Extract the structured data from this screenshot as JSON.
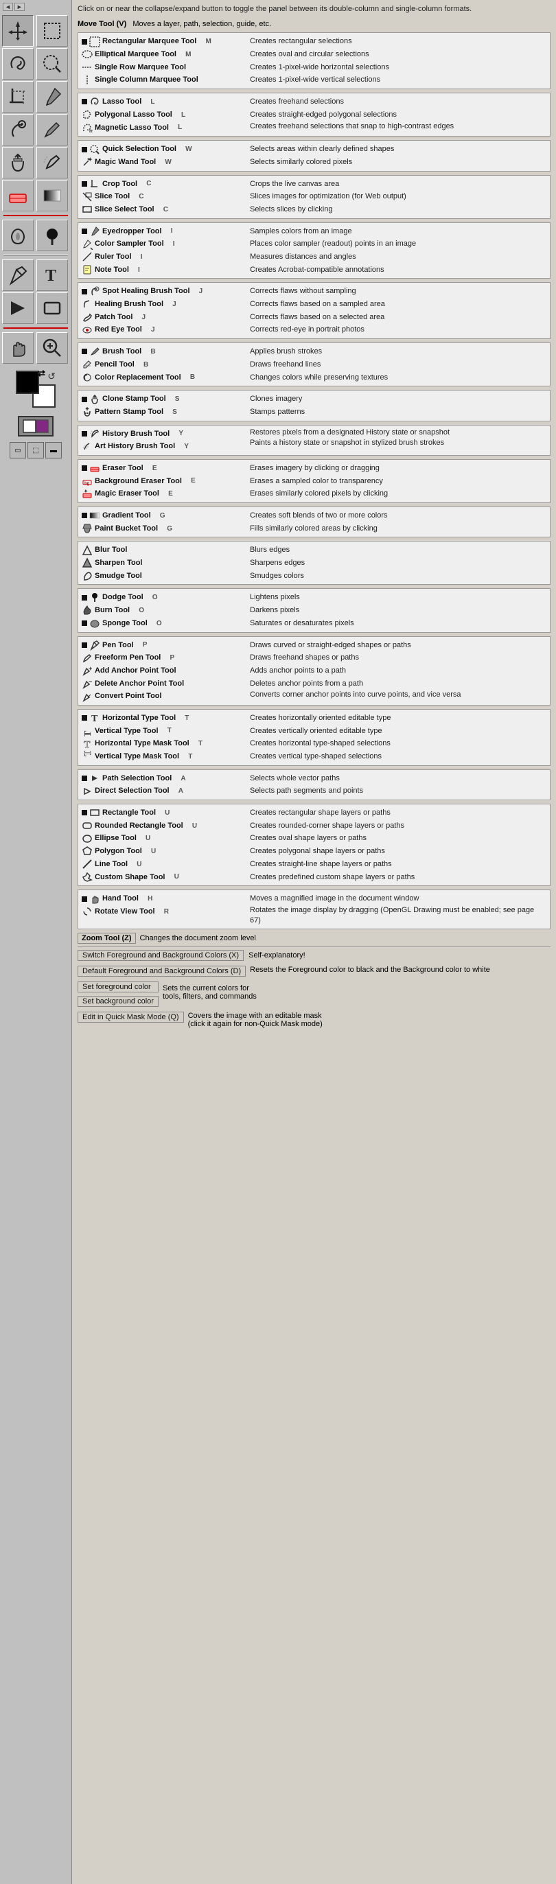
{
  "intro": {
    "text": "Click on or near the collapse/expand button to toggle the panel between its double-column and single-column formats."
  },
  "move_tool": {
    "label": "Move Tool (V)",
    "desc": "Moves a layer, path, selection, guide, etc."
  },
  "groups": [
    {
      "id": "marquee",
      "tools": [
        {
          "name": "Rectangular Marquee Tool",
          "shortcut": "M",
          "desc": "Creates rectangular selections",
          "icon": "rect-marquee"
        },
        {
          "name": "Elliptical Marquee Tool",
          "shortcut": "M",
          "desc": "Creates oval and circular selections",
          "icon": "ellipse-marquee"
        },
        {
          "name": "Single Row Marquee Tool",
          "shortcut": "",
          "desc": "Creates 1-pixel-wide horizontal selections",
          "icon": "single-row"
        },
        {
          "name": "Single Column Marquee Tool",
          "shortcut": "",
          "desc": "Creates 1-pixel-wide vertical selections",
          "icon": "single-col"
        }
      ]
    },
    {
      "id": "lasso",
      "tools": [
        {
          "name": "Lasso Tool",
          "shortcut": "L",
          "desc": "Creates freehand selections",
          "icon": "lasso"
        },
        {
          "name": "Polygonal Lasso Tool",
          "shortcut": "L",
          "desc": "Creates straight-edged polygonal selections",
          "icon": "poly-lasso"
        },
        {
          "name": "Magnetic Lasso Tool",
          "shortcut": "L",
          "desc": "Creates freehand selections that snap to high-contrast edges",
          "icon": "mag-lasso"
        }
      ]
    },
    {
      "id": "selection",
      "tools": [
        {
          "name": "Quick Selection Tool",
          "shortcut": "W",
          "desc": "Selects areas within clearly defined shapes",
          "icon": "quick-sel"
        },
        {
          "name": "Magic Wand Tool",
          "shortcut": "W",
          "desc": "Selects similarly colored pixels",
          "icon": "magic-wand"
        }
      ]
    },
    {
      "id": "crop",
      "tools": [
        {
          "name": "Crop Tool",
          "shortcut": "C",
          "desc": "Crops the live canvas area",
          "icon": "crop"
        },
        {
          "name": "Slice Tool",
          "shortcut": "C",
          "desc": "Slices images for optimization (for Web output)",
          "icon": "slice"
        },
        {
          "name": "Slice Select Tool",
          "shortcut": "C",
          "desc": "Selects slices by clicking",
          "icon": "slice-sel"
        }
      ]
    },
    {
      "id": "eyedropper",
      "tools": [
        {
          "name": "Eyedropper Tool",
          "shortcut": "I",
          "desc": "Samples colors from an image",
          "icon": "eyedropper"
        },
        {
          "name": "Color Sampler Tool",
          "shortcut": "I",
          "desc": "Places color sampler (readout) points in an image",
          "icon": "color-sampler"
        },
        {
          "name": "Ruler Tool",
          "shortcut": "I",
          "desc": "Measures distances and angles",
          "icon": "ruler"
        },
        {
          "name": "Note Tool",
          "shortcut": "I",
          "desc": "Creates Acrobat-compatible annotations",
          "icon": "note"
        }
      ]
    },
    {
      "id": "healing",
      "tools": [
        {
          "name": "Spot Healing Brush Tool",
          "shortcut": "J",
          "desc": "Corrects flaws without sampling",
          "icon": "spot-heal"
        },
        {
          "name": "Healing Brush Tool",
          "shortcut": "J",
          "desc": "Corrects flaws based on a sampled area",
          "icon": "heal"
        },
        {
          "name": "Patch Tool",
          "shortcut": "J",
          "desc": "Corrects flaws based on a selected area",
          "icon": "patch"
        },
        {
          "name": "Red Eye Tool",
          "shortcut": "J",
          "desc": "Corrects red-eye in portrait photos",
          "icon": "red-eye"
        }
      ]
    },
    {
      "id": "brush",
      "tools": [
        {
          "name": "Brush Tool",
          "shortcut": "B",
          "desc": "Applies brush strokes",
          "icon": "brush"
        },
        {
          "name": "Pencil Tool",
          "shortcut": "B",
          "desc": "Draws freehand lines",
          "icon": "pencil"
        },
        {
          "name": "Color Replacement Tool",
          "shortcut": "B",
          "desc": "Changes colors while preserving textures",
          "icon": "color-replace"
        }
      ]
    },
    {
      "id": "stamp",
      "tools": [
        {
          "name": "Clone Stamp Tool",
          "shortcut": "S",
          "desc": "Clones imagery",
          "icon": "clone-stamp"
        },
        {
          "name": "Pattern Stamp Tool",
          "shortcut": "S",
          "desc": "Stamps patterns",
          "icon": "pattern-stamp"
        }
      ]
    },
    {
      "id": "history-brush",
      "tools": [
        {
          "name": "History Brush Tool",
          "shortcut": "Y",
          "desc": "Restores pixels from a designated History state or snapshot",
          "icon": "history-brush"
        },
        {
          "name": "Art History Brush Tool",
          "shortcut": "Y",
          "desc": "Paints a history state or snapshot in stylized brush strokes",
          "icon": "art-history-brush"
        }
      ]
    },
    {
      "id": "eraser",
      "tools": [
        {
          "name": "Eraser Tool",
          "shortcut": "E",
          "desc": "Erases imagery by clicking or dragging",
          "icon": "eraser"
        },
        {
          "name": "Background Eraser Tool",
          "shortcut": "E",
          "desc": "Erases a sampled color to transparency",
          "icon": "bg-eraser"
        },
        {
          "name": "Magic Eraser Tool",
          "shortcut": "E",
          "desc": "Erases similarly colored pixels by clicking",
          "icon": "magic-eraser"
        }
      ]
    },
    {
      "id": "gradient",
      "tools": [
        {
          "name": "Gradient Tool",
          "shortcut": "G",
          "desc": "Creates soft blends of two or more colors",
          "icon": "gradient"
        },
        {
          "name": "Paint Bucket Tool",
          "shortcut": "G",
          "desc": "Fills similarly colored areas by clicking",
          "icon": "paint-bucket"
        }
      ]
    },
    {
      "id": "blur",
      "tools": [
        {
          "name": "Blur Tool",
          "shortcut": "",
          "desc": "Blurs edges",
          "icon": "blur"
        },
        {
          "name": "Sharpen Tool",
          "shortcut": "",
          "desc": "Sharpens edges",
          "icon": "sharpen"
        },
        {
          "name": "Smudge Tool",
          "shortcut": "",
          "desc": "Smudges colors",
          "icon": "smudge"
        }
      ]
    },
    {
      "id": "dodge",
      "tools": [
        {
          "name": "Dodge Tool",
          "shortcut": "O",
          "desc": "Lightens pixels",
          "icon": "dodge"
        },
        {
          "name": "Burn Tool",
          "shortcut": "O",
          "desc": "Darkens pixels",
          "icon": "burn"
        },
        {
          "name": "Sponge Tool",
          "shortcut": "O",
          "desc": "Saturates or desaturates pixels",
          "icon": "sponge"
        }
      ]
    },
    {
      "id": "pen",
      "tools": [
        {
          "name": "Pen Tool",
          "shortcut": "P",
          "desc": "Draws curved or straight-edged shapes or paths",
          "icon": "pen"
        },
        {
          "name": "Freeform Pen Tool",
          "shortcut": "P",
          "desc": "Draws freehand shapes or paths",
          "icon": "free-pen"
        },
        {
          "name": "Add Anchor Point Tool",
          "shortcut": "",
          "desc": "Adds anchor points to a path",
          "icon": "add-anchor"
        },
        {
          "name": "Delete Anchor Point Tool",
          "shortcut": "",
          "desc": "Deletes anchor points from a path",
          "icon": "del-anchor"
        },
        {
          "name": "Convert Point Tool",
          "shortcut": "",
          "desc": "Converts corner anchor points into curve points, and vice versa",
          "icon": "convert-point"
        }
      ]
    },
    {
      "id": "type",
      "tools": [
        {
          "name": "Horizontal Type Tool",
          "shortcut": "T",
          "desc": "Creates horizontally oriented editable type",
          "icon": "h-type"
        },
        {
          "name": "Vertical Type Tool",
          "shortcut": "T",
          "desc": "Creates vertically oriented editable type",
          "icon": "v-type"
        },
        {
          "name": "Horizontal Type Mask Tool",
          "shortcut": "T",
          "desc": "Creates horizontal type-shaped selections",
          "icon": "h-type-mask"
        },
        {
          "name": "Vertical Type Mask Tool",
          "shortcut": "T",
          "desc": "Creates vertical type-shaped selections",
          "icon": "v-type-mask"
        }
      ]
    },
    {
      "id": "path-selection",
      "tools": [
        {
          "name": "Path Selection Tool",
          "shortcut": "A",
          "desc": "Selects whole vector paths",
          "icon": "path-sel"
        },
        {
          "name": "Direct Selection Tool",
          "shortcut": "A",
          "desc": "Selects path segments and points",
          "icon": "direct-sel"
        }
      ]
    },
    {
      "id": "shapes",
      "tools": [
        {
          "name": "Rectangle Tool",
          "shortcut": "U",
          "desc": "Creates rectangular shape layers or paths",
          "icon": "rect-shape"
        },
        {
          "name": "Rounded Rectangle Tool",
          "shortcut": "U",
          "desc": "Creates rounded-corner shape layers or paths",
          "icon": "round-rect"
        },
        {
          "name": "Ellipse Tool",
          "shortcut": "U",
          "desc": "Creates oval shape layers or paths",
          "icon": "ellipse-shape"
        },
        {
          "name": "Polygon Tool",
          "shortcut": "U",
          "desc": "Creates polygonal shape layers or paths",
          "icon": "polygon"
        },
        {
          "name": "Line Tool",
          "shortcut": "U",
          "desc": "Creates straight-line shape layers or paths",
          "icon": "line-shape"
        },
        {
          "name": "Custom Shape Tool",
          "shortcut": "U",
          "desc": "Creates predefined custom shape layers or paths",
          "icon": "custom-shape"
        }
      ]
    },
    {
      "id": "navigation",
      "tools": [
        {
          "name": "Hand Tool",
          "shortcut": "H",
          "desc": "Moves a magnified image in the document window",
          "icon": "hand"
        },
        {
          "name": "Rotate View Tool",
          "shortcut": "R",
          "desc": "Rotates the image display by dragging (OpenGL Drawing must be enabled; see page 67)",
          "icon": "rotate-view"
        }
      ]
    }
  ],
  "zoom_tool": {
    "label": "Zoom Tool (Z)",
    "desc": "Changes the document zoom level"
  },
  "special_controls": [
    {
      "id": "switch-fg-bg",
      "label": "Switch Foreground and Background Colors (X)",
      "desc": "Self-explanatory!"
    },
    {
      "id": "default-fg-bg",
      "label": "Default Foreground and Background Colors (D)",
      "desc": "Resets the Foreground color to black and the Background color to white"
    },
    {
      "id": "set-fg",
      "label": "Set foreground color",
      "desc": "Sets the current colors for tools, filters, and commands"
    },
    {
      "id": "set-bg",
      "label": "Set background color",
      "desc": ""
    },
    {
      "id": "quick-mask",
      "label": "Edit in Quick Mask Mode (Q)",
      "desc": "Covers the image with an editable mask (click it again for non-Quick Mask mode)"
    }
  ],
  "sidebar": {
    "tools": [
      "move",
      "rect-marquee",
      "lasso",
      "quick-sel",
      "crop-tool",
      "eyedropper",
      "spot-heal",
      "brush-tool",
      "clone-stamp",
      "history-brush",
      "eraser-tool",
      "gradient-tool",
      "blur-tool",
      "dodge-tool",
      "pen-tool",
      "type-tool",
      "path-sel-tool",
      "shape-tool",
      "hand-tool",
      "zoom-tool"
    ]
  }
}
